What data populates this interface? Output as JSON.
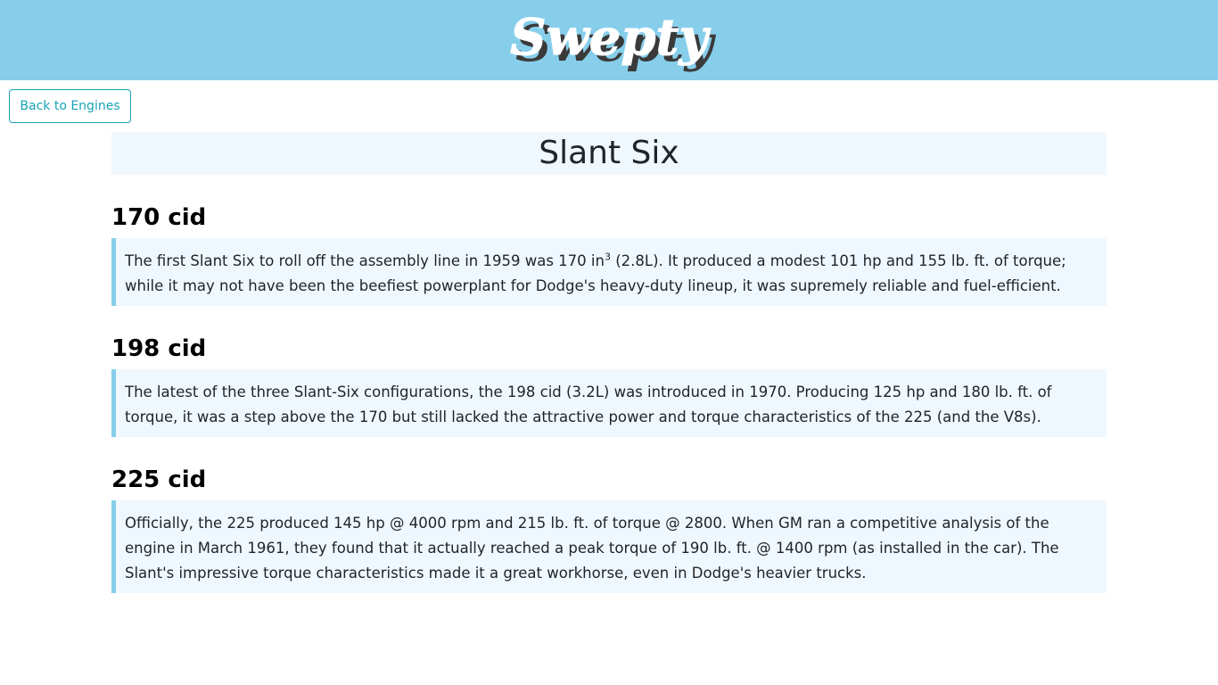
{
  "header": {
    "logo_text": "Swepty",
    "background_color": "#87ceeb"
  },
  "nav": {
    "back_label": "Back to Engines",
    "accent_color": "#17a2b8"
  },
  "page": {
    "title": "Slant Six"
  },
  "sections": [
    {
      "heading": "170 cid",
      "body_before_sup": "The first Slant Six to roll off the assembly line in 1959 was 170 in",
      "sup": "3",
      "body_after_sup": " (2.8L). It produced a modest 101 hp and 155 lb. ft. of torque; while it may not have been the beefiest powerplant for Dodge's heavy-duty lineup, it was supremely reliable and fuel-efficient."
    },
    {
      "heading": "198 cid",
      "body": "The latest of the three Slant-Six configurations, the 198 cid (3.2L) was introduced in 1970. Producing 125 hp and 180 lb. ft. of torque, it was a step above the 170 but still lacked the attractive power and torque characteristics of the 225 (and the V8s)."
    },
    {
      "heading": "225 cid",
      "body": "Officially, the 225 produced 145 hp @ 4000 rpm and 215 lb. ft. of torque @ 2800. When GM ran a competitive analysis of the engine in March 1961, they found that it actually reached a peak torque of 190 lb. ft. @ 1400 rpm (as installed in the car). The Slant's impressive torque characteristics made it a great workhorse, even in Dodge's heavier trucks."
    }
  ]
}
